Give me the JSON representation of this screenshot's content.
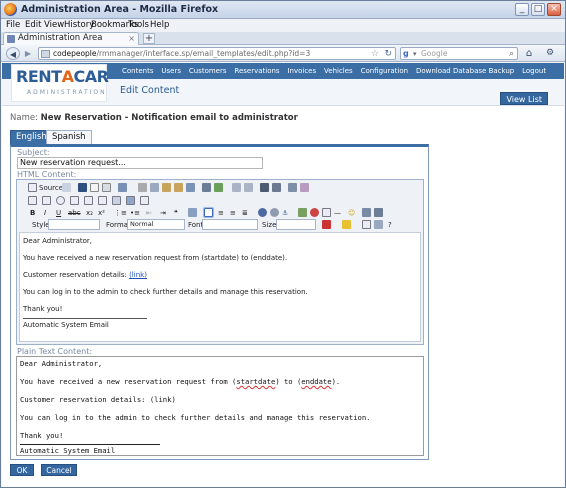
{
  "window": {
    "title": "Administration Area - Mozilla Firefox",
    "controls": {
      "minimize": "_",
      "maximize": "□",
      "close": "×"
    }
  },
  "menu": [
    "File",
    "Edit",
    "View",
    "History",
    "Bookmarks",
    "Tools",
    "Help"
  ],
  "browser_tab": {
    "label": "Administration Area",
    "close": "×",
    "new_tab": "+"
  },
  "nav": {
    "back": "◀",
    "forward": "▶",
    "url_domain": "codepeople",
    "url_path": "/rmmanager/interface.sp/email_templates/edit.php?id=3",
    "search_placeholder": "Google",
    "search_engine": "g",
    "home": "⌂",
    "tools": "⚙"
  },
  "app": {
    "logo_main_a": "RENT",
    "logo_main_b": "A",
    "logo_main_c": "CAR",
    "logo_sub": "ADMINISTRATION",
    "top_nav": [
      "Contents",
      "Users",
      "Customers",
      "Reservations",
      "Invoices",
      "Vehicles",
      "Configuration",
      "Download Database Backup",
      "Logout"
    ],
    "page_title": "Edit Content",
    "view_list": "View List",
    "name_label": "Name:",
    "name_value": "New Reservation - Notification email to administrator",
    "lang_tabs": [
      "English",
      "Spanish"
    ]
  },
  "form": {
    "subject_label": "Subject:",
    "subject_value": "New reservation request...",
    "html_label": "HTML Content:",
    "plain_label": "Plain Text Content:",
    "toolbar": {
      "source": "Source",
      "style_label": "Style",
      "format_label": "Format",
      "format_value": "Normal",
      "font_label": "Font",
      "size_label": "Size"
    },
    "html_body": {
      "greeting": "Dear Administrator,",
      "line1": "You have received a new reservation request from (startdate) to (enddate).",
      "details_label": "Customer reservation details:",
      "details_link": "(link)",
      "line3": "You can log in to the admin to check further details and manage this reservation.",
      "thanks": "Thank you!",
      "signature": "Automatic System Email"
    },
    "plain_body": {
      "greeting": "Dear Administrator,",
      "line1_a": "You have received a new reservation request from (",
      "line1_startdate": "startdate",
      "line1_b": ") to (",
      "line1_enddate": "enddate",
      "line1_c": ").",
      "details": "Customer reservation details: (link)",
      "line3": "You can log in to the admin to check further details and manage this reservation.",
      "thanks": "Thank you!",
      "signature": "Automatic System Email"
    },
    "ok": "OK",
    "cancel": "Cancel"
  }
}
